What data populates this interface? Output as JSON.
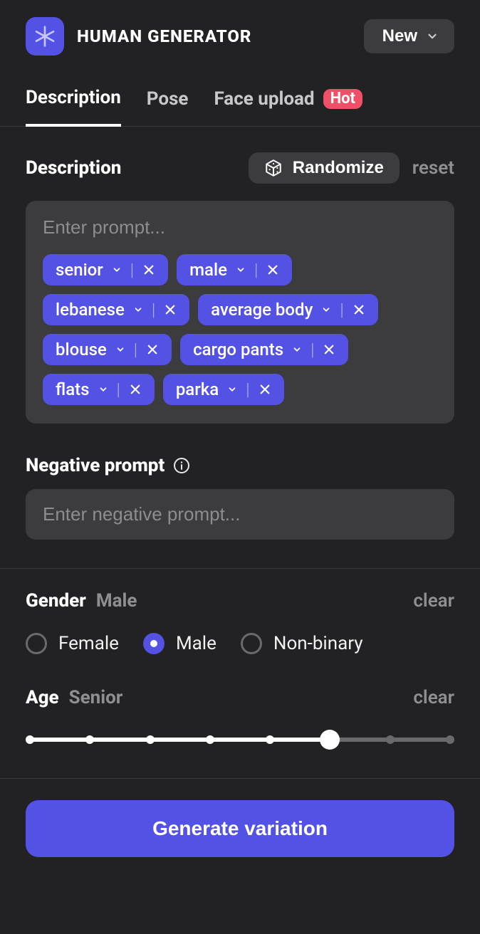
{
  "header": {
    "brand_title": "HUMAN GENERATOR",
    "new_label": "New"
  },
  "tabs": [
    {
      "label": "Description",
      "active": true,
      "badge": null
    },
    {
      "label": "Pose",
      "active": false,
      "badge": null
    },
    {
      "label": "Face upload",
      "active": false,
      "badge": "Hot"
    }
  ],
  "description": {
    "section_title": "Description",
    "randomize_label": "Randomize",
    "reset_label": "reset",
    "prompt_placeholder": "Enter prompt...",
    "chips": [
      {
        "label": "senior"
      },
      {
        "label": "male"
      },
      {
        "label": "lebanese"
      },
      {
        "label": "average body"
      },
      {
        "label": "blouse"
      },
      {
        "label": "cargo pants"
      },
      {
        "label": "flats"
      },
      {
        "label": "parka"
      }
    ]
  },
  "negative_prompt": {
    "section_title": "Negative prompt",
    "placeholder": "Enter negative prompt..."
  },
  "gender": {
    "title": "Gender",
    "value": "Male",
    "clear_label": "clear",
    "options": [
      {
        "label": "Female",
        "checked": false
      },
      {
        "label": "Male",
        "checked": true
      },
      {
        "label": "Non-binary",
        "checked": false
      }
    ]
  },
  "age": {
    "title": "Age",
    "value": "Senior",
    "clear_label": "clear",
    "ticks_total": 8,
    "selected_index": 6
  },
  "cta": {
    "label": "Generate variation"
  }
}
